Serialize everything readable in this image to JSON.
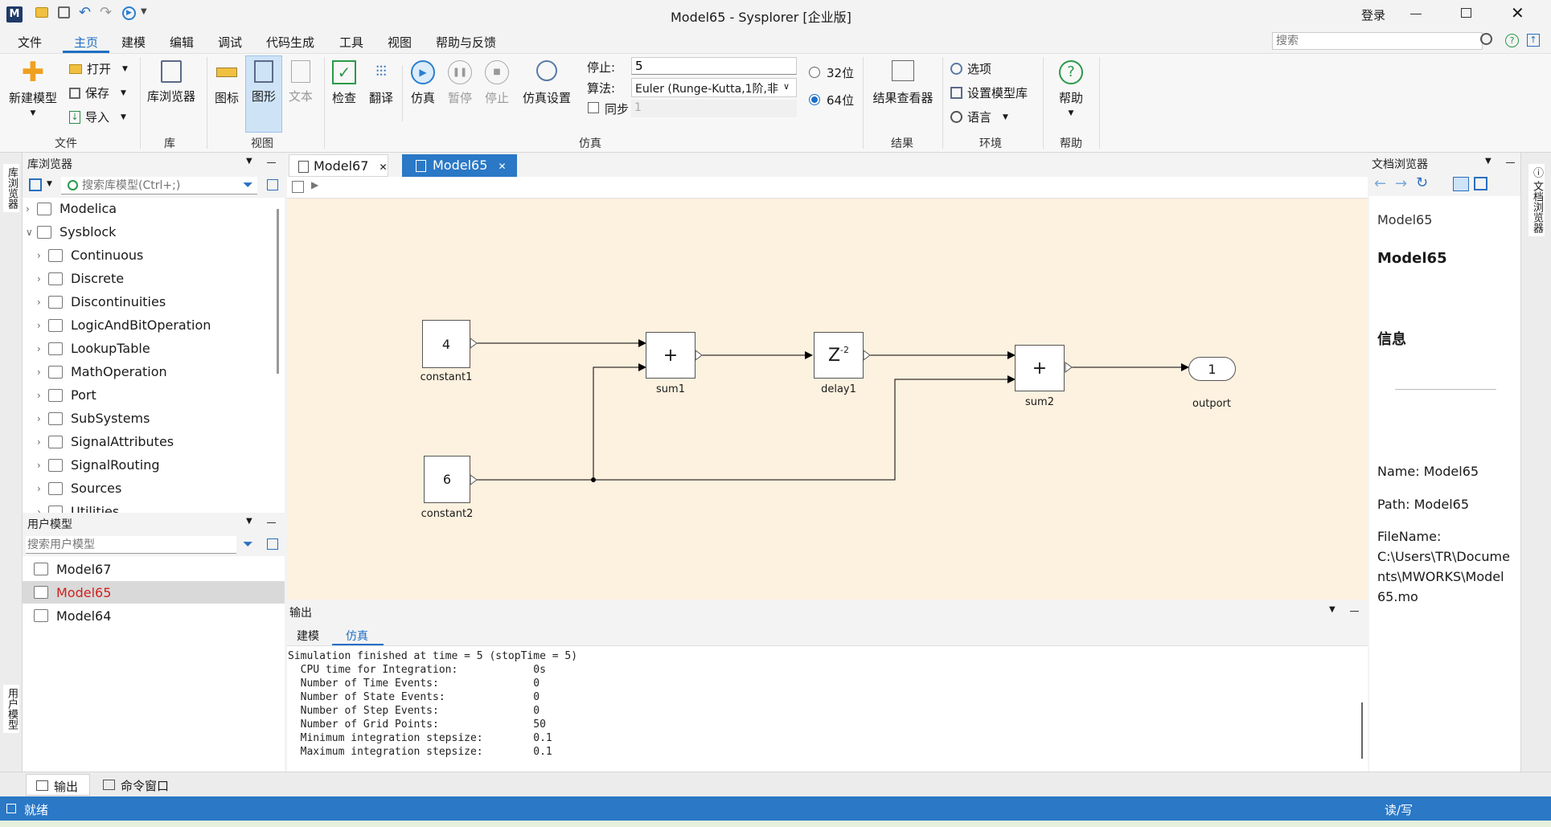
{
  "window": {
    "title": "Model65 - Sysplorer [企业版]",
    "login": "登录"
  },
  "menu": [
    "文件",
    "主页",
    "建模",
    "编辑",
    "调试",
    "代码生成",
    "工具",
    "视图",
    "帮助与反馈"
  ],
  "search_placeholder": "搜索",
  "ribbon": {
    "file": {
      "new_model": "新建模型",
      "open": "打开",
      "save": "保存",
      "import": "导入",
      "group": "文件"
    },
    "lib": {
      "browser": "库浏览器",
      "group": "库"
    },
    "view": {
      "icon": "图标",
      "graphic": "图形",
      "text": "文本",
      "group": "视图"
    },
    "sim": {
      "check": "检查",
      "translate": "翻译",
      "simulate": "仿真",
      "pause": "暂停",
      "stop": "停止",
      "settings": "仿真设置",
      "stop_label": "停止:",
      "stop_value": "5",
      "algo_label": "算法:",
      "algo_value": "Euler (Runge-Kutta,1阶,非",
      "sync_label": "同步",
      "sync_value": "1",
      "bit32": "32位",
      "bit64": "64位",
      "group": "仿真"
    },
    "result": {
      "viewer": "结果查看器",
      "group": "结果"
    },
    "env": {
      "options": "选项",
      "set_lib": "设置模型库",
      "language": "语言",
      "group": "环境"
    },
    "help": {
      "help": "帮助",
      "group": "帮助"
    }
  },
  "left_vtabs": {
    "lib": "库浏览器",
    "user": "用户模型"
  },
  "lib_panel": {
    "title": "库浏览器",
    "search_placeholder": "搜索库模型(Ctrl+;)",
    "items": [
      {
        "label": "Modelica",
        "level": 0,
        "expanded": false
      },
      {
        "label": "Sysblock",
        "level": 0,
        "expanded": true
      },
      {
        "label": "Continuous",
        "level": 1
      },
      {
        "label": "Discrete",
        "level": 1
      },
      {
        "label": "Discontinuities",
        "level": 1
      },
      {
        "label": "LogicAndBitOperation",
        "level": 1
      },
      {
        "label": "LookupTable",
        "level": 1
      },
      {
        "label": "MathOperation",
        "level": 1
      },
      {
        "label": "Port",
        "level": 1
      },
      {
        "label": "SubSystems",
        "level": 1
      },
      {
        "label": "SignalAttributes",
        "level": 1
      },
      {
        "label": "SignalRouting",
        "level": 1
      },
      {
        "label": "Sources",
        "level": 1
      },
      {
        "label": "Utilities",
        "level": 1
      }
    ]
  },
  "user_panel": {
    "title": "用户模型",
    "search_placeholder": "搜索用户模型",
    "items": [
      {
        "label": "Model67",
        "selected": false
      },
      {
        "label": "Model65",
        "selected": true
      },
      {
        "label": "Model64",
        "selected": false
      }
    ]
  },
  "tabs": [
    {
      "label": "Model67",
      "active": false
    },
    {
      "label": "Model65",
      "active": true
    }
  ],
  "diagram": {
    "blocks": [
      {
        "id": "constant1",
        "text": "4",
        "label": "constant1"
      },
      {
        "id": "constant2",
        "text": "6",
        "label": "constant2"
      },
      {
        "id": "sum1",
        "text": "+",
        "label": "sum1"
      },
      {
        "id": "delay1",
        "text": "Z",
        "sup": "-2",
        "label": "delay1"
      },
      {
        "id": "sum2",
        "text": "+",
        "label": "sum2"
      },
      {
        "id": "outport",
        "text": "1",
        "label": "outport"
      }
    ]
  },
  "output": {
    "title": "输出",
    "tabs": [
      "建模",
      "仿真"
    ],
    "active_tab": "仿真",
    "lines": [
      "Simulation finished at time = 5 (stopTime = 5)",
      "  CPU time for Integration:            0s",
      "  Number of Time Events:               0",
      "  Number of State Events:              0",
      "  Number of Step Events:               0",
      "  Number of Grid Points:               50",
      "  Minimum integration stepsize:        0.1",
      "  Maximum integration stepsize:        0.1"
    ]
  },
  "doc_panel": {
    "title": "文档浏览器",
    "vtab": "文档浏览器",
    "model_small": "Model65",
    "model_big": "Model65",
    "info": "信息",
    "name": "Name: Model65",
    "path": "Path: Model65",
    "filename_label": "FileName:",
    "filename_lines": [
      "C:\\Users\\TR\\Docume",
      "nts\\MWORKS\\Model",
      "65.mo"
    ]
  },
  "bottom_tabs": {
    "output": "输出",
    "cmd": "命令窗口"
  },
  "status": {
    "left": "就绪",
    "right": "读/写"
  }
}
